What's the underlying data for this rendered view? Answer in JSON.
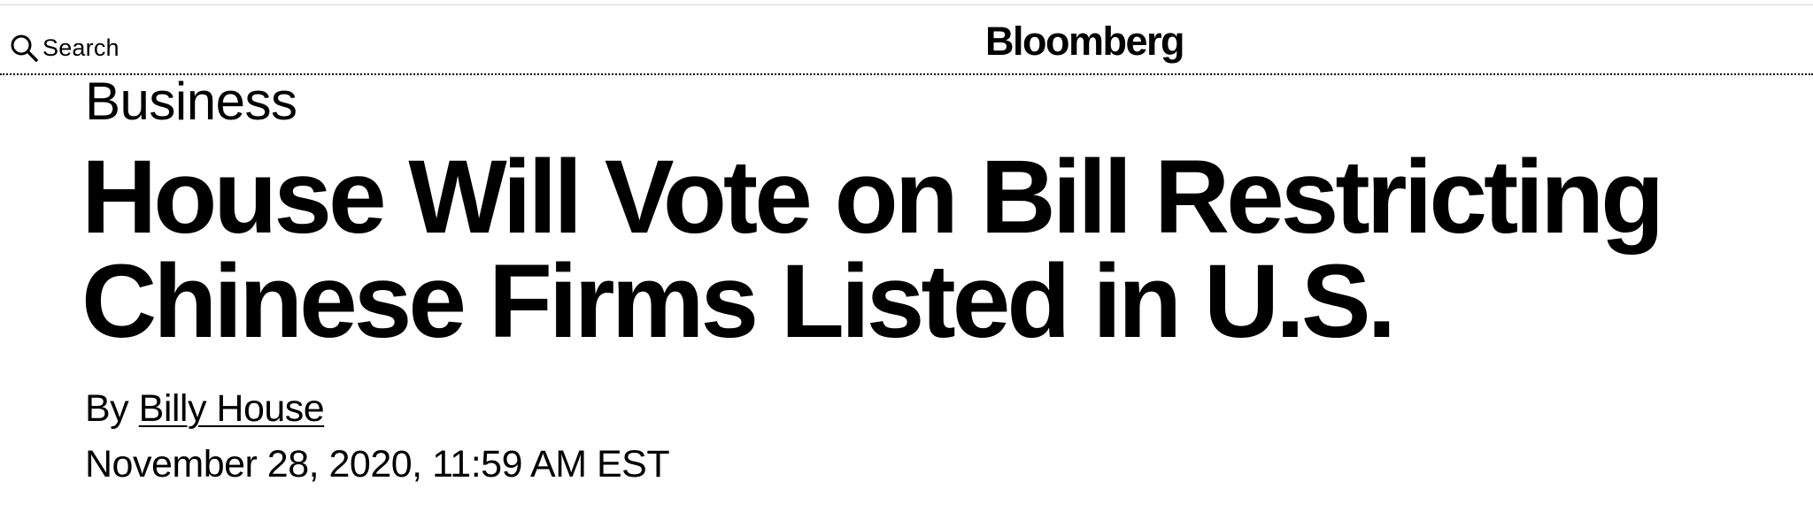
{
  "header": {
    "search_label": "Search",
    "search_icon": "search-icon",
    "logo_text": "Bloomberg"
  },
  "article": {
    "section": "Business",
    "headline": "House Will Vote on Bill Restricting Chinese Firms Listed in U.S.",
    "byline_prefix": "By",
    "author": "Billy House",
    "date": "November 28, 2020, 11:59 AM EST"
  },
  "colors": {
    "text": "#000000",
    "background": "#ffffff",
    "top_rule": "#d9d9d9"
  }
}
